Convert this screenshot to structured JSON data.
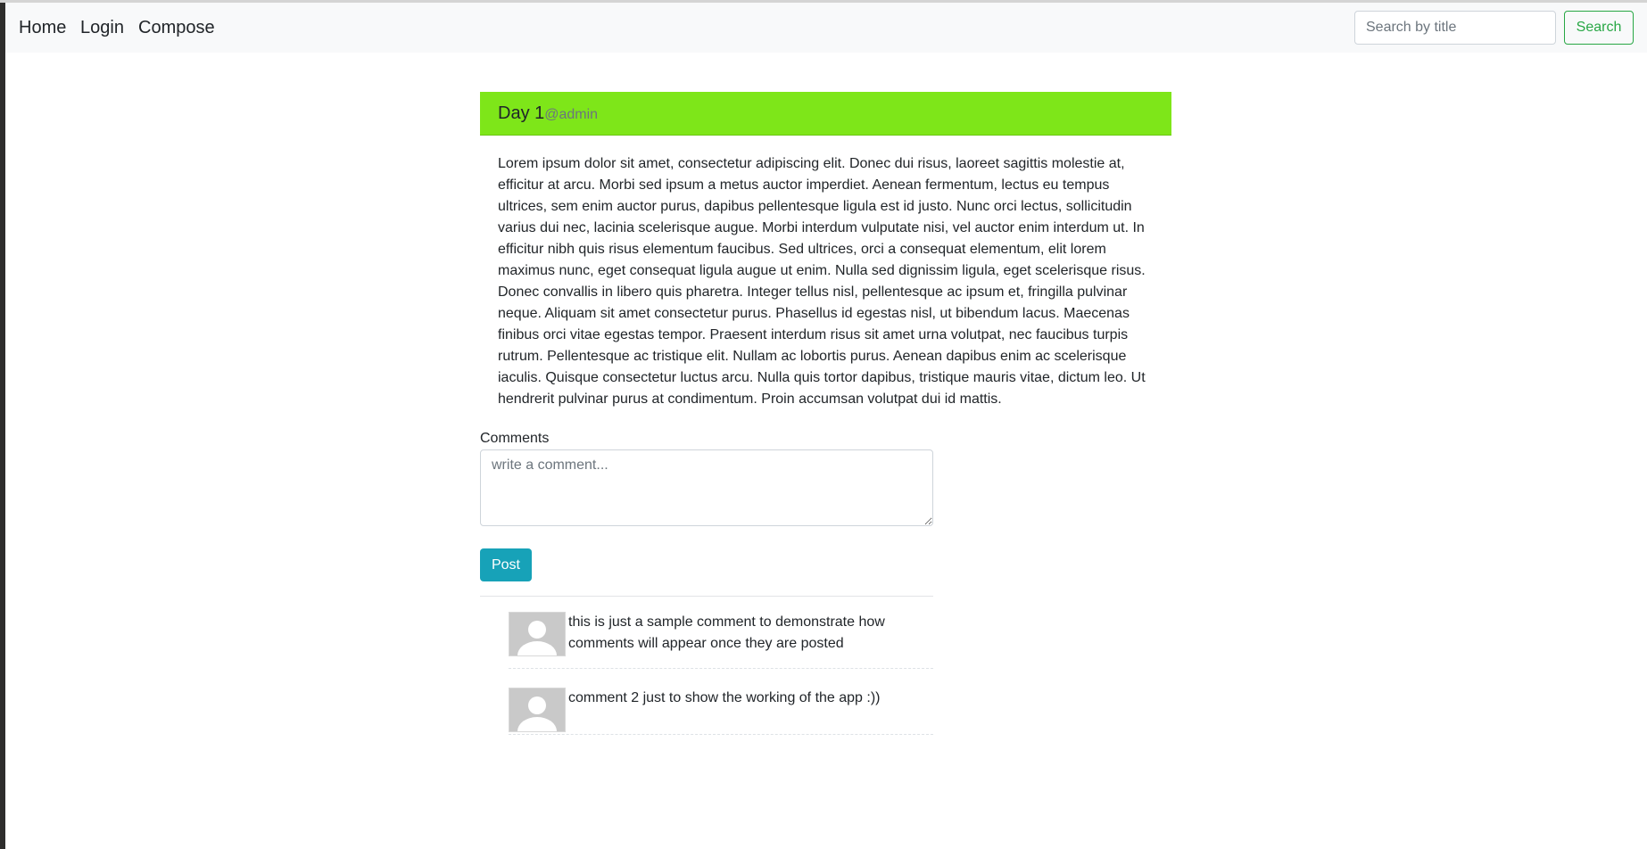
{
  "nav": {
    "home": "Home",
    "login": "Login",
    "compose": "Compose"
  },
  "search": {
    "placeholder": "Search by title",
    "button_label": "Search"
  },
  "post": {
    "title": "Day 1",
    "author": "@admin",
    "header_color": "#7ee619",
    "body": "Lorem ipsum dolor sit amet, consectetur adipiscing elit. Donec dui risus, laoreet sagittis molestie at, efficitur at arcu. Morbi sed ipsum a metus auctor imperdiet. Aenean fermentum, lectus eu tempus ultrices, sem enim auctor purus, dapibus pellentesque ligula est id justo. Nunc orci lectus, sollicitudin varius dui nec, lacinia scelerisque augue. Morbi interdum vulputate nisi, vel auctor enim interdum ut. In efficitur nibh quis risus elementum faucibus. Sed ultrices, orci a consequat elementum, elit lorem maximus nunc, eget consequat ligula augue ut enim. Nulla sed dignissim ligula, eget scelerisque risus. Donec convallis in libero quis pharetra. Integer tellus nisl, pellentesque ac ipsum et, fringilla pulvinar neque. Aliquam sit amet consectetur purus. Phasellus id egestas nisl, ut bibendum lacus. Maecenas finibus orci vitae egestas tempor. Praesent interdum risus sit amet urna volutpat, nec faucibus turpis rutrum. Pellentesque ac tristique elit. Nullam ac lobortis purus. Aenean dapibus enim ac scelerisque iaculis. Quisque consectetur luctus arcu. Nulla quis tortor dapibus, tristique mauris vitae, dictum leo. Ut hendrerit pulvinar purus at condimentum. Proin accumsan volutpat dui id mattis."
  },
  "comments": {
    "label": "Comments",
    "placeholder": "write a comment...",
    "post_button": "Post",
    "post_button_color": "#17a2b8",
    "items": [
      {
        "avatar_icon": "user-avatar-icon",
        "text": "this is just a sample comment to demonstrate how comments will appear once they are posted"
      },
      {
        "avatar_icon": "user-avatar-icon",
        "text": "comment 2 just to show the working of the app :))"
      }
    ]
  }
}
